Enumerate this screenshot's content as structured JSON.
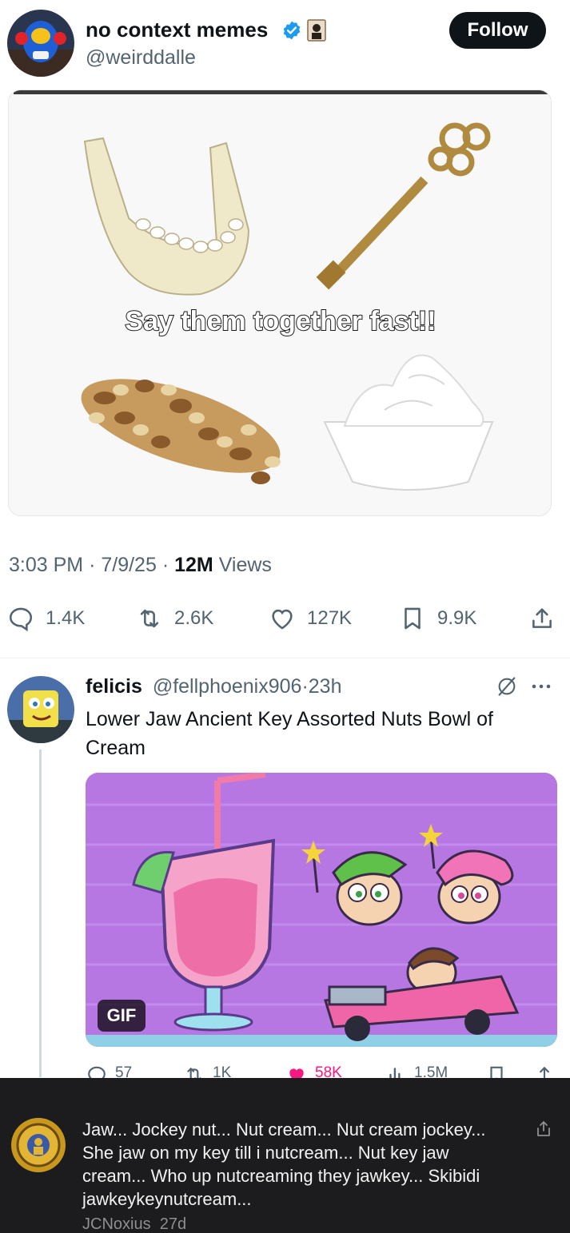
{
  "post": {
    "author_name": "no context memes",
    "handle": "@weirddalle",
    "follow_label": "Follow",
    "image_caption": "Say them together fast!!",
    "time": "3:03 PM",
    "date": "7/9/25",
    "views_count": "12M",
    "views_label": "Views",
    "sep": "·",
    "stats": {
      "replies": "1.4K",
      "reposts": "2.6K",
      "likes": "127K",
      "bookmarks": "9.9K"
    }
  },
  "reply": {
    "author_name": "felicis",
    "handle": "@fellphoenix906",
    "age": "23h",
    "sep": "·",
    "text": "Lower Jaw Ancient Key Assorted Nuts Bowl of Cream",
    "gif_label": "GIF",
    "stats": {
      "replies": "57",
      "reposts": "1K",
      "likes": "58K",
      "views": "1.5M"
    }
  },
  "comment": {
    "text": "Jaw... Jockey nut... Nut cream... Nut cream jockey... She jaw on my key till i nutcream... Nut key jaw cream... Who up nutcreaming they jawkey... Skibidi jawkeykeynutcream...",
    "author": "JCNoxius",
    "age": "27d"
  },
  "colors": {
    "accent_blue": "#1d9bf0",
    "like_pink": "#f91880",
    "follow_bg": "#0f1419",
    "dark_panel": "#1c1c1e"
  }
}
